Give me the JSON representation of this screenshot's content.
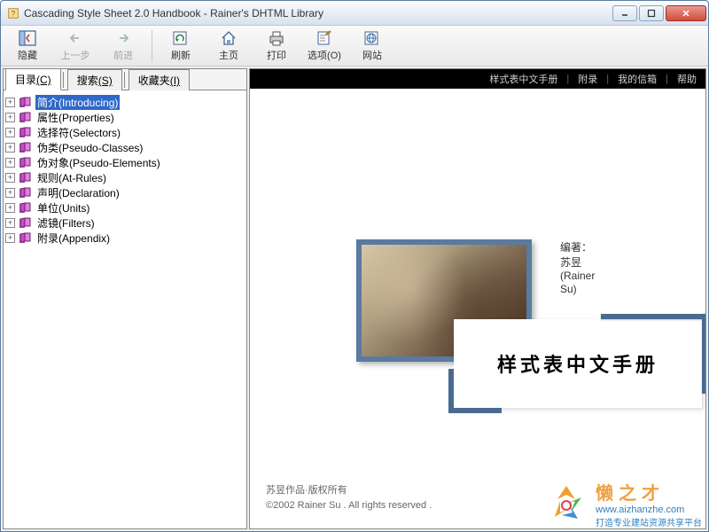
{
  "window": {
    "title": "Cascading Style Sheet 2.0 Handbook - Rainer's DHTML Library"
  },
  "toolbar": {
    "hide": "隐藏",
    "back": "上一步",
    "forward": "前进",
    "refresh": "刷新",
    "home": "主页",
    "print": "打印",
    "options": "选项(O)",
    "website": "网站"
  },
  "tabs": {
    "toc": "目录",
    "toc_key": "(C)",
    "search": "搜索",
    "search_key": "(S)",
    "fav": "收藏夹",
    "fav_key": "(I)"
  },
  "tree": [
    {
      "label": "简介(Introducing)",
      "selected": true
    },
    {
      "label": "属性(Properties)"
    },
    {
      "label": "选择符(Selectors)"
    },
    {
      "label": "伪类(Pseudo-Classes)"
    },
    {
      "label": "伪对象(Pseudo-Elements)"
    },
    {
      "label": "规则(At-Rules)"
    },
    {
      "label": "声明(Declaration)"
    },
    {
      "label": "单位(Units)"
    },
    {
      "label": "滤镜(Filters)"
    },
    {
      "label": "附录(Appendix)"
    }
  ],
  "nav": {
    "manual": "样式表中文手册",
    "appendix": "附录",
    "mailbox": "我的信箱",
    "help": "帮助"
  },
  "hero": {
    "author_prefix": "编著：",
    "author": "苏昱(Rainer Su)",
    "title": "样式表中文手册"
  },
  "footer": {
    "line1": "苏昱作品·版权所有",
    "line2": "©2002 Rainer Su . All rights reserved ."
  },
  "watermark": {
    "title": "懒之才",
    "url": "www.aizhanzhe.com",
    "sub": "打造专业建站资源共享平台"
  }
}
